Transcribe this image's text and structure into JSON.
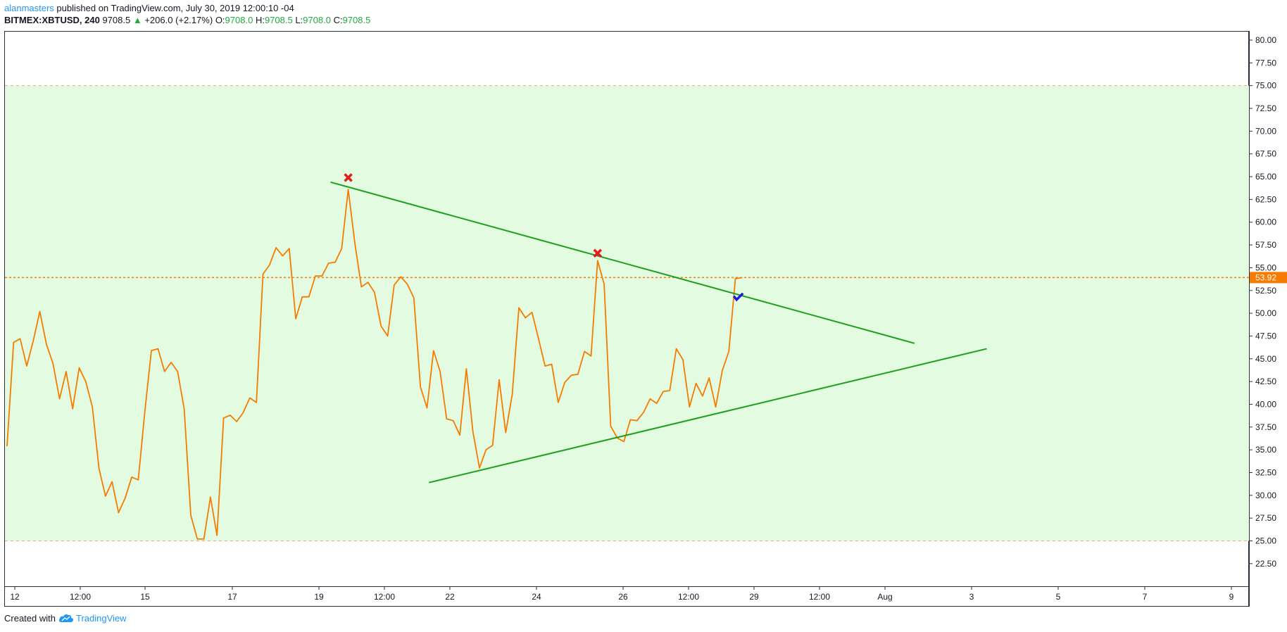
{
  "header": {
    "author": "alanmasters",
    "published": " published on TradingView.com, July 30, 2019 12:00:10 -04",
    "symbol": "BITMEX:XBTUSD, 240",
    "price": "9708.5",
    "change": "+206.0 (+2.17%)",
    "o_label": "O:",
    "o_value": "9708.0",
    "h_label": "H:",
    "h_value": "9708.5",
    "l_label": "L:",
    "l_value": "9708.0",
    "c_label": "C:",
    "c_value": "9708.5"
  },
  "footer": {
    "created_with": "Created with",
    "brand": "TradingView",
    "icon": "tradingview-cloud-icon"
  },
  "colors": {
    "line": "#f57c00",
    "trendline": "#1ea01e",
    "zone_fill": "#e3fbe1",
    "zone_border": "#f4a582",
    "current_price": "#f57c00",
    "cross_marker": "#e31c1c",
    "check_marker": "#1a1adc"
  },
  "chart_data": {
    "type": "line",
    "indicator_range": [
      20,
      81.5
    ],
    "y_ticks": [
      "80.00",
      "77.50",
      "75.00",
      "72.50",
      "70.00",
      "67.50",
      "65.00",
      "62.50",
      "60.00",
      "57.50",
      "55.00",
      "52.50",
      "50.00",
      "47.50",
      "45.00",
      "42.50",
      "40.00",
      "37.50",
      "35.00",
      "32.50",
      "30.00",
      "27.50",
      "25.00",
      "22.50"
    ],
    "x_ticks": [
      "12",
      "12:00",
      "15",
      "17",
      "19",
      "12:00",
      "22",
      "24",
      "26",
      "12:00",
      "29",
      "12:00",
      "Aug",
      "3",
      "5",
      "7",
      "9"
    ],
    "values": [
      35.4,
      46.8,
      47.2,
      44.2,
      47,
      50.2,
      46.6,
      44.5,
      40.6,
      43.6,
      39.5,
      44,
      42.5,
      39.7,
      33,
      29.9,
      31.5,
      28.1,
      29.7,
      32,
      31.7,
      39.2,
      45.9,
      46.1,
      43.6,
      44.6,
      43.6,
      39.5,
      27.8,
      25.2,
      25.2,
      29.8,
      25.6,
      38.5,
      38.8,
      38.1,
      39.1,
      40.7,
      40.2,
      54.3,
      55.3,
      57.2,
      56.3,
      57.1,
      49.4,
      51.8,
      51.8,
      54.1,
      54.1,
      55.5,
      55.6,
      57.1,
      63.6,
      57.7,
      52.9,
      53.4,
      52.3,
      48.6,
      47.5,
      53.1,
      54,
      53.2,
      51.7,
      41.9,
      39.6,
      45.9,
      43.6,
      38.4,
      38.2,
      36.6,
      43.9,
      37,
      33,
      35,
      35.5,
      42.7,
      36.9,
      41.1,
      50.6,
      49.5,
      50.1,
      47.2,
      44.2,
      44.4,
      40.2,
      42.4,
      43.2,
      43.3,
      45.8,
      45.3,
      55.8,
      53.2,
      37.6,
      36.3,
      35.9,
      38.3,
      38.2,
      39.1,
      40.6,
      40.1,
      41.4,
      41.5,
      46.1,
      44.9,
      39.7,
      42.3,
      40.9,
      42.9,
      39.7,
      43.7,
      45.8,
      53.8,
      53.9
    ],
    "zone": {
      "upper": 75,
      "lower": 25
    },
    "current_value": 53.92,
    "current_label": "53.92",
    "trendlines": [
      {
        "name": "resistance",
        "from": {
          "i": 49.3,
          "v": 64.4
        },
        "to": {
          "i": 138.3,
          "v": 46.7
        }
      },
      {
        "name": "support",
        "from": {
          "i": 64.3,
          "v": 31.4
        },
        "to": {
          "i": 149.3,
          "v": 46.1
        }
      }
    ],
    "markers": [
      {
        "type": "cross",
        "i": 52,
        "v": 64.9
      },
      {
        "type": "cross",
        "i": 90,
        "v": 56.6
      },
      {
        "type": "check",
        "i": 111.4,
        "v": 51.8
      }
    ]
  }
}
